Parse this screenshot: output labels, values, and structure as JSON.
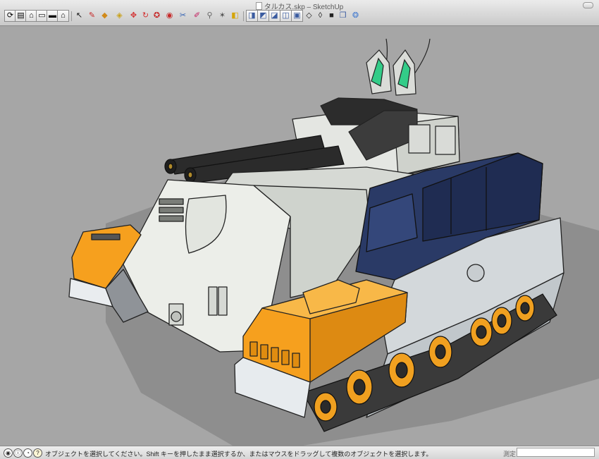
{
  "window": {
    "title": "タルカス.skp – SketchUp"
  },
  "toolbar": {
    "buttons": [
      {
        "name": "orbit-icon",
        "glyph": "⟳"
      },
      {
        "name": "open-file-icon",
        "glyph": "▤"
      },
      {
        "name": "home-view-icon",
        "glyph": "⌂"
      },
      {
        "name": "top-view-icon",
        "glyph": "▭"
      },
      {
        "name": "front-view-icon",
        "glyph": "▬"
      },
      {
        "name": "house-icon",
        "glyph": "⌂"
      },
      {
        "name": "select-arrow-icon",
        "glyph": "↖"
      },
      {
        "name": "pencil-icon",
        "glyph": "✎"
      },
      {
        "name": "paint-bucket-icon",
        "glyph": "◆"
      },
      {
        "name": "push-pull-icon",
        "glyph": "◈"
      },
      {
        "name": "move-icon",
        "glyph": "✥"
      },
      {
        "name": "rotate-icon",
        "glyph": "↻"
      },
      {
        "name": "follow-me-icon",
        "glyph": "✪"
      },
      {
        "name": "offset-icon",
        "glyph": "◉"
      },
      {
        "name": "tape-measure-icon",
        "glyph": "✂"
      },
      {
        "name": "eraser-icon",
        "glyph": "✐"
      },
      {
        "name": "zoom-icon",
        "glyph": "⚲"
      },
      {
        "name": "zoom-extents-icon",
        "glyph": "✶"
      },
      {
        "name": "iso-view-icon",
        "glyph": "◧"
      },
      {
        "name": "top-view-box-icon",
        "glyph": "◨"
      },
      {
        "name": "front-view-box-icon",
        "glyph": "◩"
      },
      {
        "name": "right-view-box-icon",
        "glyph": "◪"
      },
      {
        "name": "back-view-box-icon",
        "glyph": "◫"
      },
      {
        "name": "left-view-box-icon",
        "glyph": "▣"
      },
      {
        "name": "xray-icon",
        "glyph": "◇"
      },
      {
        "name": "wireframe-icon",
        "glyph": "◊"
      },
      {
        "name": "solid-icon",
        "glyph": "■"
      },
      {
        "name": "component-box-icon",
        "glyph": "❒"
      },
      {
        "name": "extension-icon",
        "glyph": "❂"
      }
    ]
  },
  "status": {
    "message": "オブジェクトを選択してください。Shift キーを押したまま選択するか、またはマウスをドラッグして複数のオブジェクトを選択します。",
    "measure_label": "測定",
    "measure_value": ""
  },
  "colors": {
    "background": "#a6a6a6",
    "body_white": "#e9ebe6",
    "armor_orange": "#f6a01e",
    "cab_navy": "#2a3a66",
    "side_gray": "#d3d8db",
    "cannon_black": "#2b2b2b",
    "sensor_green": "#33cc88"
  }
}
